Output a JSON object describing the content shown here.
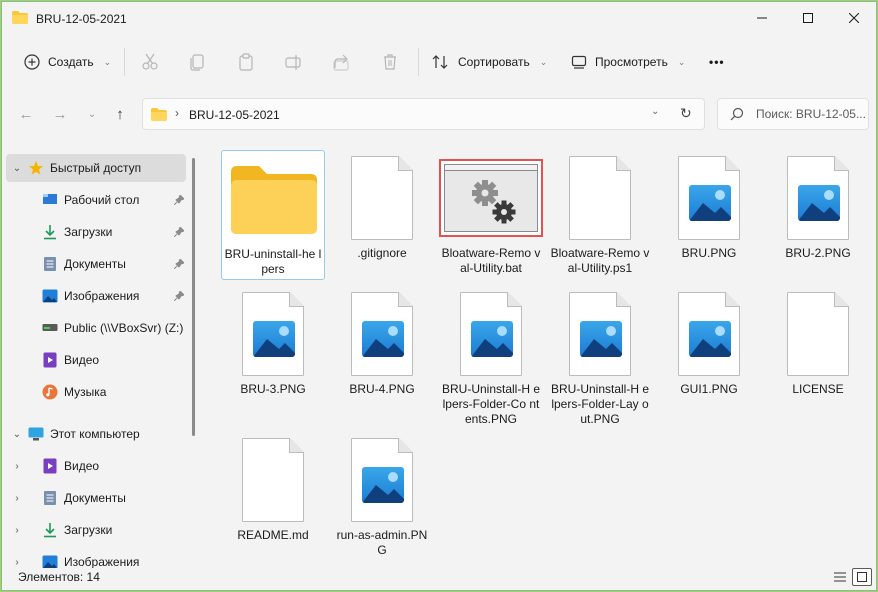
{
  "window": {
    "title": "BRU-12-05-2021"
  },
  "toolbar": {
    "create_label": "Создать",
    "sort_label": "Сортировать",
    "view_label": "Просмотреть",
    "more_label": "•••"
  },
  "address": {
    "path": "BRU-12-05-2021",
    "separator": "›"
  },
  "search": {
    "placeholder": "Поиск: BRU-12-05..."
  },
  "sidebar": {
    "items": [
      {
        "label": "Быстрый доступ",
        "icon": "star-icon"
      },
      {
        "label": "Рабочий стол",
        "icon": "desktop-icon"
      },
      {
        "label": "Загрузки",
        "icon": "download-icon"
      },
      {
        "label": "Документы",
        "icon": "documents-icon"
      },
      {
        "label": "Изображения",
        "icon": "pictures-icon"
      },
      {
        "label": "Public (\\\\VBoxSvr) (Z:)",
        "icon": "network-drive-icon"
      },
      {
        "label": "Видео",
        "icon": "video-icon"
      },
      {
        "label": "Музыка",
        "icon": "music-icon"
      },
      {
        "label": "Этот компьютер",
        "icon": "computer-icon"
      },
      {
        "label": "Видео",
        "icon": "video-icon"
      },
      {
        "label": "Документы",
        "icon": "documents-icon"
      },
      {
        "label": "Загрузки",
        "icon": "download-icon"
      },
      {
        "label": "Изображения",
        "icon": "pictures-icon"
      }
    ]
  },
  "files": [
    {
      "name": "BRU-uninstall-helpers",
      "display": "BRU-uninstall-he lpers",
      "type": "folder"
    },
    {
      "name": ".gitignore",
      "display": ".gitignore",
      "type": "file"
    },
    {
      "name": "Bloatware-Removal-Utility.bat",
      "display": "Bloatware-Remo val-Utility.bat",
      "type": "bat"
    },
    {
      "name": "Bloatware-Removal-Utility.ps1",
      "display": "Bloatware-Remo val-Utility.ps1",
      "type": "file"
    },
    {
      "name": "BRU.PNG",
      "display": "BRU.PNG",
      "type": "image"
    },
    {
      "name": "BRU-2.PNG",
      "display": "BRU-2.PNG",
      "type": "image"
    },
    {
      "name": "BRU-3.PNG",
      "display": "BRU-3.PNG",
      "type": "image"
    },
    {
      "name": "BRU-4.PNG",
      "display": "BRU-4.PNG",
      "type": "image"
    },
    {
      "name": "BRU-Uninstall-Helpers-Folder-Contents.PNG",
      "display": "BRU-Uninstall-H elpers-Folder-Co ntents.PNG",
      "type": "image"
    },
    {
      "name": "BRU-Uninstall-Helpers-Folder-Layout.PNG",
      "display": "BRU-Uninstall-H elpers-Folder-Lay out.PNG",
      "type": "image"
    },
    {
      "name": "GUI1.PNG",
      "display": "GUI1.PNG",
      "type": "image"
    },
    {
      "name": "LICENSE",
      "display": "LICENSE",
      "type": "file"
    },
    {
      "name": "README.md",
      "display": "README.md",
      "type": "file"
    },
    {
      "name": "run-as-admin.PNG",
      "display": "run-as-admin.PN G",
      "type": "image"
    }
  ],
  "status": {
    "count_text": "Элементов: 14"
  },
  "colors": {
    "accent": "#0067c0",
    "folder": "#f8c83a",
    "selection_border": "#99c9ec",
    "highlight_red": "#e35151"
  }
}
